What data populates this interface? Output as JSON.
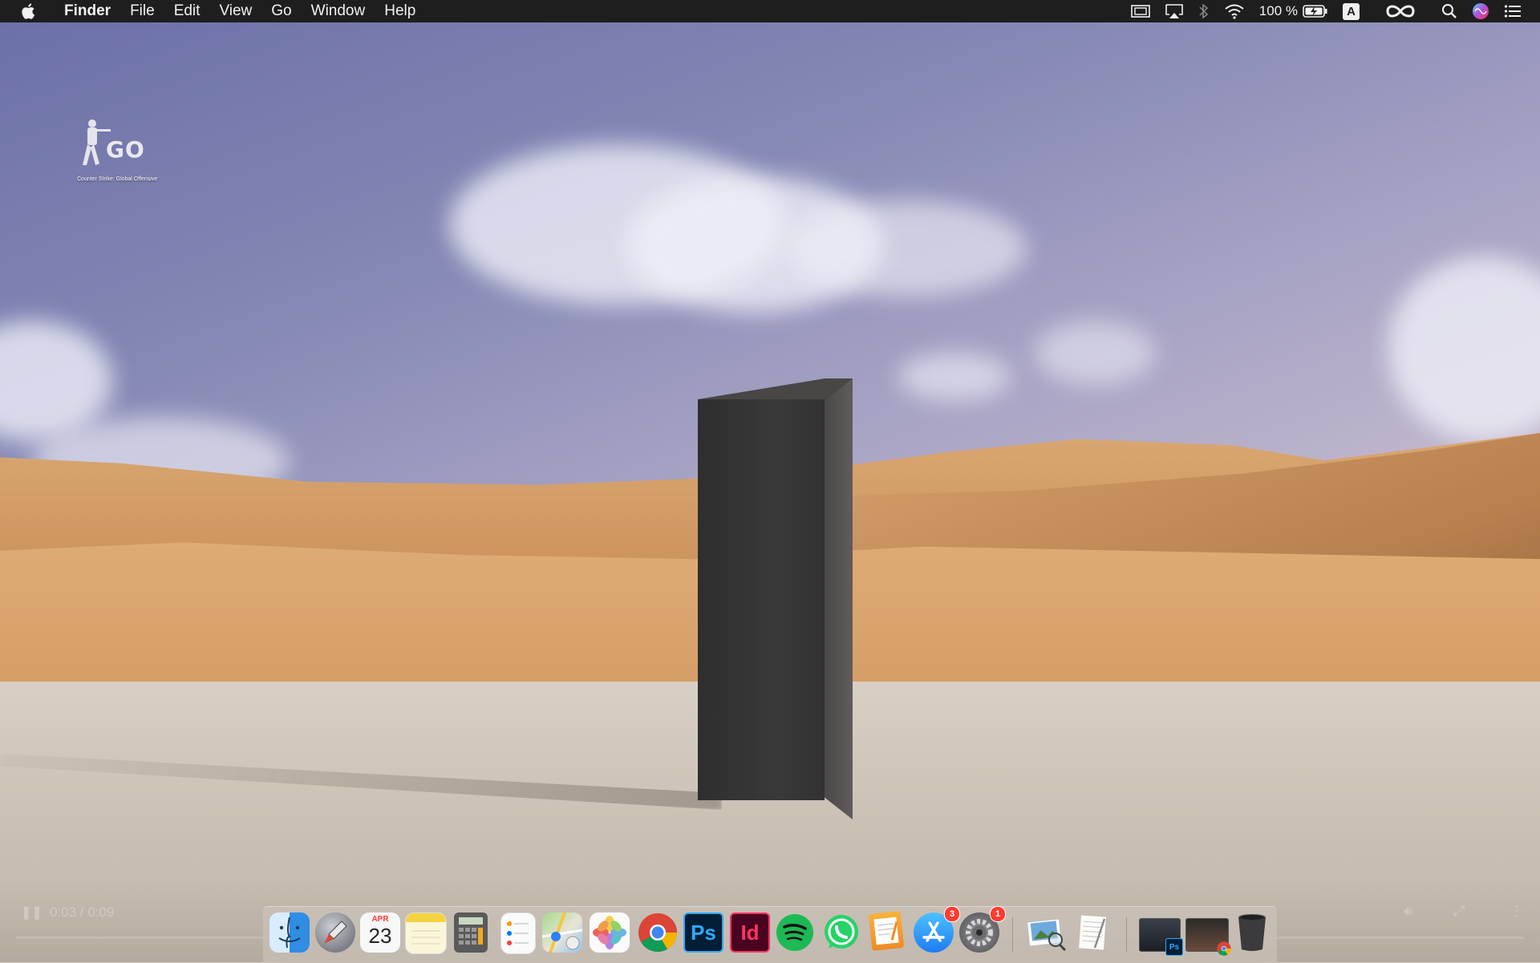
{
  "menubar": {
    "app_name": "Finder",
    "items": [
      "File",
      "Edit",
      "View",
      "Go",
      "Window",
      "Help"
    ],
    "battery_percent": "100 %",
    "input_source": "A"
  },
  "desktop": {
    "icons": [
      {
        "label": "Counter Strike: Global Offensive",
        "logo_text": "GO"
      }
    ]
  },
  "video_player": {
    "time": "0:03 / 0:09"
  },
  "dock": {
    "apps": [
      {
        "name": "Finder",
        "icon": "finder-icon"
      },
      {
        "name": "Launchpad",
        "icon": "launchpad-icon"
      },
      {
        "name": "Calendar",
        "icon": "calendar-icon",
        "month": "APR",
        "day": "23"
      },
      {
        "name": "Notes",
        "icon": "notes-icon"
      },
      {
        "name": "Calculator",
        "icon": "calculator-icon"
      },
      {
        "name": "Reminders",
        "icon": "reminders-icon"
      },
      {
        "name": "Maps",
        "icon": "maps-icon"
      },
      {
        "name": "Photos",
        "icon": "photos-icon"
      },
      {
        "name": "Google Chrome",
        "icon": "chrome-icon"
      },
      {
        "name": "Photoshop",
        "icon": "photoshop-icon",
        "glyph": "Ps"
      },
      {
        "name": "InDesign",
        "icon": "indesign-icon",
        "glyph": "Id"
      },
      {
        "name": "Spotify",
        "icon": "spotify-icon"
      },
      {
        "name": "WhatsApp",
        "icon": "whatsapp-icon"
      },
      {
        "name": "Pages",
        "icon": "pages-icon"
      },
      {
        "name": "App Store",
        "icon": "app-store-icon",
        "badge": "3"
      },
      {
        "name": "System Preferences",
        "icon": "system-preferences-icon",
        "badge": "1"
      },
      {
        "name": "Preview",
        "icon": "preview-icon"
      },
      {
        "name": "TextEdit",
        "icon": "textedit-icon"
      },
      {
        "name": "Photoshop Window",
        "icon": "photoshop-window-thumbnail",
        "glyph": "Ps"
      },
      {
        "name": "Chrome Window",
        "icon": "chrome-window-thumbnail"
      },
      {
        "name": "Trash",
        "icon": "trash-icon"
      }
    ]
  },
  "colors": {
    "menubar_bg": "#1e1e1e",
    "badge_red": "#ff3b30",
    "photoshop_blue": "#31a8ff",
    "indesign_pink": "#ff3366",
    "spotify_green": "#1db954",
    "whatsapp_green": "#25d366"
  }
}
